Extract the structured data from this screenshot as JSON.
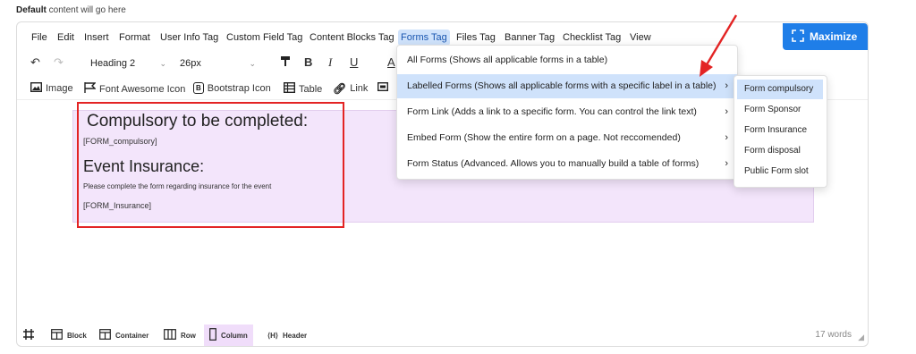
{
  "top_label": {
    "bold": "Default",
    "rest": " content will go here"
  },
  "menubar": {
    "items": [
      "File",
      "Edit",
      "Insert",
      "Format",
      "User Info Tag",
      "Custom Field Tag",
      "Content Blocks Tag",
      "Forms Tag",
      "Files Tag",
      "Banner Tag",
      "Checklist Tag",
      "View"
    ],
    "active": "Forms Tag",
    "maximize_label": "Maximize"
  },
  "toolbar": {
    "block_format": "Heading 2",
    "font_size": "26px",
    "bold": "B",
    "italic": "I",
    "underline": "U",
    "text_color": "A"
  },
  "toolbar2": {
    "items": [
      "Image",
      "Font Awesome Icon",
      "Bootstrap Icon",
      "Table",
      "Link"
    ]
  },
  "content": {
    "heading1": "Compulsory to be completed:",
    "text1": "[FORM_compulsory]",
    "heading2": "Event Insurance:",
    "text2": "Please complete the form regarding insurance for the event",
    "text3": "[FORM_Insurance]"
  },
  "dropdown": {
    "items": [
      "All Forms (Shows all applicable forms in a table)",
      "Labelled Forms (Shows all applicable forms with a specific label in a table)",
      "Form Link (Adds a link to a specific form. You can control the link text)",
      "Embed Form (Show the entire form on a page. Not reccomended)",
      "Form Status (Advanced. Allows you to manually build a table of forms)"
    ],
    "highlighted": 1
  },
  "submenu": {
    "items": [
      "Form compulsory",
      "Form Sponsor",
      "Form Insurance",
      "Form disposal",
      "Public Form slot"
    ],
    "highlighted": 0
  },
  "statusbar": {
    "items": [
      "Block",
      "Container",
      "Row",
      "Column",
      "Header"
    ],
    "selected": "Column",
    "word_count": "17 words"
  },
  "colors": {
    "accent": "#1f7ee8",
    "highlight": "#cfe2fb",
    "annotation_red": "#e32424",
    "column_bg": "#f3e5fb"
  },
  "icons": {
    "maximize": "expand-icon",
    "undo": "undo-icon",
    "redo": "redo-icon",
    "grid": "grid-icon"
  }
}
